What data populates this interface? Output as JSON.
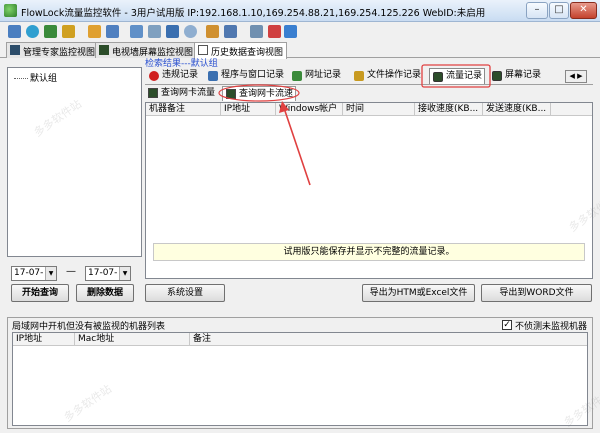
{
  "window": {
    "title": "FlowLock流量监控软件 - 3用户试用版 IP:192.168.1.10,169.254.88.21,169.254.125.226 WebID:未启用",
    "minimize": "–",
    "maximize": "□",
    "close": "✕"
  },
  "toolbar": {
    "icons": [
      "monitor-policy-icon",
      "globe-icon",
      "shield-icon",
      "users-icon",
      "tools-icon",
      "arrows-icon",
      "screen-icon",
      "gauge-icon",
      "photo-icon",
      "compass-icon",
      "pipe-icon",
      "window-icon",
      "list-icon",
      "cart-icon",
      "help-icon"
    ]
  },
  "main_tabs": [
    {
      "label": "管理专家监控视图"
    },
    {
      "label": "电视墙屏幕监控视图"
    },
    {
      "label": "历史数据查询视图"
    }
  ],
  "left_panel": {
    "tree_root": "默认组",
    "date_from": "17-07-",
    "date_to": "17-07-",
    "dash": "—",
    "start_query": "开始查询",
    "delete_data": "删除数据"
  },
  "results": {
    "label": "检索结果---默认组"
  },
  "record_tabs": [
    {
      "label": "违规记录",
      "color": "#d02020"
    },
    {
      "label": "程序与窗口记录",
      "color": "#3a6fb0"
    },
    {
      "label": "网址记录",
      "color": "#3a8a3a"
    },
    {
      "label": "文件操作记录",
      "color": "#c89a20"
    },
    {
      "label": "流量记录",
      "color": "#2c4d2a"
    },
    {
      "label": "屏幕记录",
      "color": "#2c4d2a"
    }
  ],
  "sub_tabs": [
    {
      "label": "查询网卡流量"
    },
    {
      "label": "查询网卡流速"
    }
  ],
  "grid_columns": [
    "机器备注",
    "IP地址",
    "Windows帐户",
    "时间",
    "接收速度(KB...",
    "发送速度(KB..."
  ],
  "trial_notice": "试用版只能保存并显示不完整的流量记录。",
  "buttons": {
    "system_settings": "系统设置",
    "export_htm": "导出为HTM或Excel文件",
    "export_word": "导出到WORD文件"
  },
  "bottom": {
    "title": "局域网中开机但没有被监视的机器列表",
    "checkbox_label": "不侦测未监视机器",
    "checkbox_mark": "✓",
    "columns": [
      "IP地址",
      "Mac地址",
      "备注"
    ]
  },
  "watermark": "多多软件站",
  "colors": {
    "highlight": "#e04040",
    "accent_link": "#2a50d0"
  }
}
